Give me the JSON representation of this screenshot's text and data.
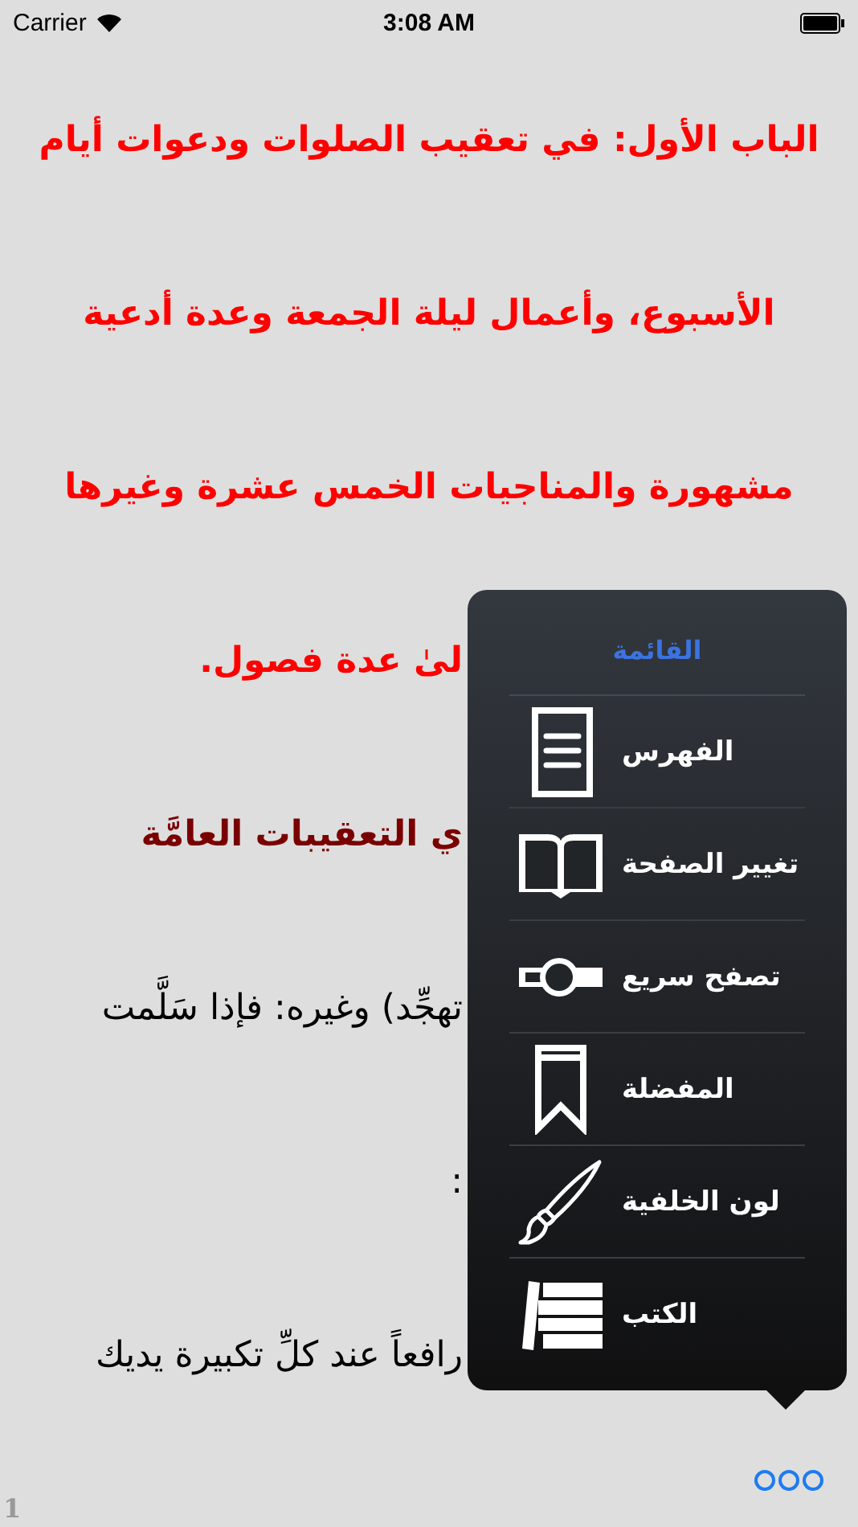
{
  "status_bar": {
    "carrier": "Carrier",
    "time": "3:08 AM"
  },
  "lines": [
    {
      "kind": "title",
      "covered": false,
      "text": "الباب الأول: في تعقيب الصلوات ودعوات أيام"
    },
    {
      "kind": "title",
      "covered": false,
      "text": "الأسبوع، وأعمال ليلة الجمعة وعدة أدعية"
    },
    {
      "kind": "title",
      "covered": false,
      "text": "مشهورة والمناجيات الخمس عشرة وغيرها"
    },
    {
      "kind": "title",
      "covered": true,
      "text": "لىٰ عدة فصول."
    },
    {
      "kind": "heading",
      "covered": true,
      "text": "ي التعقيبات العامَّة"
    },
    {
      "kind": "body",
      "covered": true,
      "text": "تهجِّد) وغيره: فإذا سَلَّمت"
    },
    {
      "kind": "body",
      "covered": true,
      "text": ":"
    },
    {
      "kind": "body",
      "covered": true,
      "text": "رافعاً عند كلِّ تكبيرة يديك"
    }
  ],
  "menu": {
    "title": "القائمة",
    "items": [
      {
        "kind": "index",
        "label": "الفهرس"
      },
      {
        "kind": "page",
        "label": "تغيير الصفحة"
      },
      {
        "kind": "slider",
        "label": "تصفح سريع"
      },
      {
        "kind": "bookmark",
        "label": "المفضلة"
      },
      {
        "kind": "brush",
        "label": "لون الخلفية"
      },
      {
        "kind": "books",
        "label": "الكتب"
      }
    ]
  },
  "page_number": "1"
}
